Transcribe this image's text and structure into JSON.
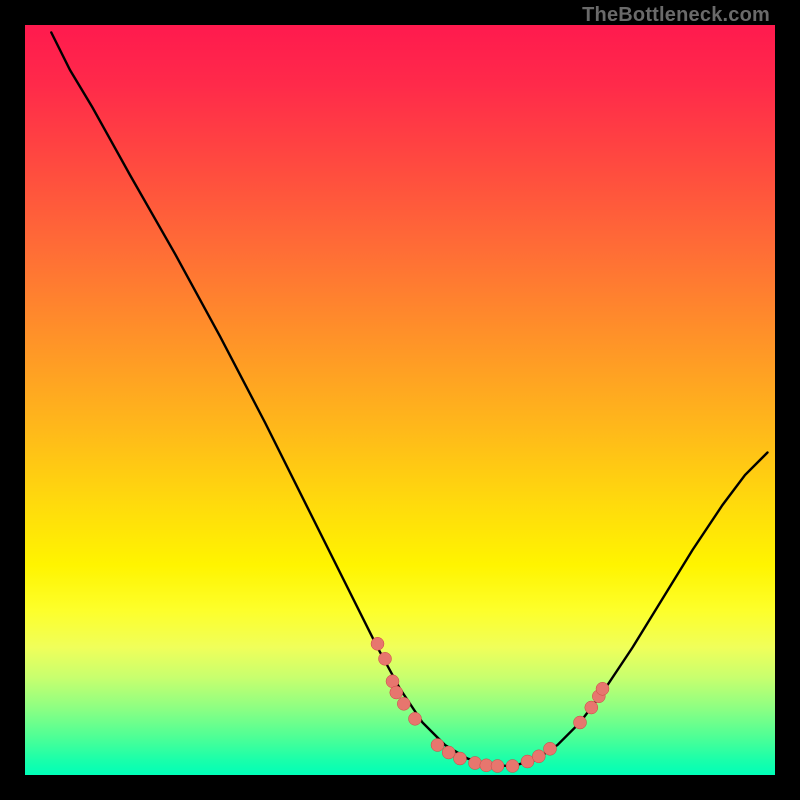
{
  "watermark": "TheBottleneck.com",
  "chart_data": {
    "type": "line",
    "title": "",
    "xlabel": "",
    "ylabel": "",
    "xlim": [
      0,
      100
    ],
    "ylim": [
      0,
      100
    ],
    "grid": false,
    "legend": false,
    "curve": [
      {
        "x": 3.5,
        "y": 99
      },
      {
        "x": 6,
        "y": 94
      },
      {
        "x": 9,
        "y": 89
      },
      {
        "x": 14,
        "y": 80
      },
      {
        "x": 20,
        "y": 69.5
      },
      {
        "x": 26,
        "y": 58.5
      },
      {
        "x": 32,
        "y": 47
      },
      {
        "x": 38,
        "y": 35
      },
      {
        "x": 43,
        "y": 25
      },
      {
        "x": 47,
        "y": 17
      },
      {
        "x": 50,
        "y": 11.5
      },
      {
        "x": 53,
        "y": 7
      },
      {
        "x": 56,
        "y": 4
      },
      {
        "x": 59,
        "y": 2.2
      },
      {
        "x": 62,
        "y": 1.3
      },
      {
        "x": 65,
        "y": 1.2
      },
      {
        "x": 68,
        "y": 2
      },
      {
        "x": 71,
        "y": 4
      },
      {
        "x": 74,
        "y": 7
      },
      {
        "x": 77,
        "y": 11
      },
      {
        "x": 81,
        "y": 17
      },
      {
        "x": 85,
        "y": 23.5
      },
      {
        "x": 89,
        "y": 30
      },
      {
        "x": 93,
        "y": 36
      },
      {
        "x": 96,
        "y": 40
      },
      {
        "x": 99,
        "y": 43
      }
    ],
    "dots": [
      {
        "x": 47,
        "y": 17.5
      },
      {
        "x": 48,
        "y": 15.5
      },
      {
        "x": 49,
        "y": 12.5
      },
      {
        "x": 49.5,
        "y": 11
      },
      {
        "x": 50.5,
        "y": 9.5
      },
      {
        "x": 52,
        "y": 7.5
      },
      {
        "x": 55,
        "y": 4
      },
      {
        "x": 56.5,
        "y": 3
      },
      {
        "x": 58,
        "y": 2.2
      },
      {
        "x": 60,
        "y": 1.6
      },
      {
        "x": 61.5,
        "y": 1.3
      },
      {
        "x": 63,
        "y": 1.2
      },
      {
        "x": 65,
        "y": 1.2
      },
      {
        "x": 67,
        "y": 1.8
      },
      {
        "x": 68.5,
        "y": 2.5
      },
      {
        "x": 70,
        "y": 3.5
      },
      {
        "x": 74,
        "y": 7
      },
      {
        "x": 75.5,
        "y": 9
      },
      {
        "x": 76.5,
        "y": 10.5
      },
      {
        "x": 77,
        "y": 11.5
      }
    ],
    "dot_color": "#e7766e"
  }
}
